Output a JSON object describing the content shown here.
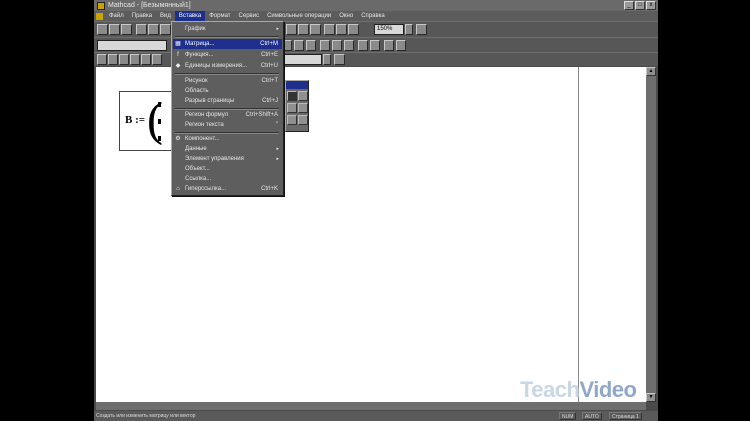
{
  "window": {
    "title": "Mathcad - [Безымянный1]",
    "controls": [
      "_",
      "□",
      "x"
    ]
  },
  "menubar": {
    "items": [
      "Файл",
      "Правка",
      "Вид",
      "Вставка",
      "Формат",
      "Сервис",
      "Символьные операции",
      "Окно",
      "Справка"
    ],
    "active_index": 3
  },
  "toolbar": {
    "zoom": "150%"
  },
  "insert_menu": {
    "items": [
      {
        "label": "График",
        "shortcut": "",
        "submenu": true
      },
      {
        "label": "Матрица...",
        "shortcut": "Ctrl+M",
        "selected": true
      },
      {
        "label": "Функция...",
        "shortcut": "Ctrl+E"
      },
      {
        "label": "Единицы измерения...",
        "shortcut": "Ctrl+U"
      },
      {
        "label": "Рисунок",
        "shortcut": "Ctrl+T"
      },
      {
        "label": "Область",
        "shortcut": ""
      },
      {
        "label": "Разрыв страницы",
        "shortcut": "Ctrl+J"
      },
      {
        "label": "Регион формул",
        "shortcut": "Ctrl+Shift+A"
      },
      {
        "label": "Регион текста",
        "shortcut": "\""
      },
      {
        "label": "Компонент...",
        "shortcut": ""
      },
      {
        "label": "Данные",
        "shortcut": "",
        "submenu": true
      },
      {
        "label": "Элемент управления",
        "shortcut": "",
        "submenu": true
      },
      {
        "label": "Объект...",
        "shortcut": ""
      },
      {
        "label": "Ссылка...",
        "shortcut": ""
      },
      {
        "label": "Гиперссылка...",
        "shortcut": "Ctrl+K"
      }
    ]
  },
  "worksheet": {
    "matrix_label": "B :="
  },
  "statusbar": {
    "hint": "Создать или изменить матрицу или вектор",
    "cap": "NUM",
    "mode": "AUTO",
    "page": "Страница 1"
  },
  "watermark": {
    "part1": "Teach",
    "part2": "Video"
  }
}
